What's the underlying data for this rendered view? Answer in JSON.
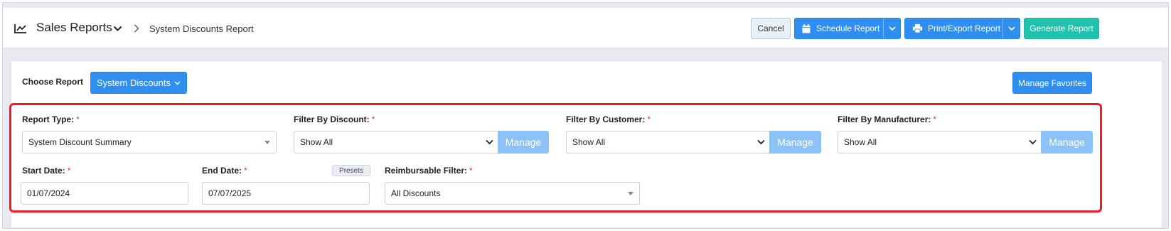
{
  "header": {
    "title": "Sales Reports",
    "breadcrumb_current": "System Discounts Report",
    "buttons": {
      "cancel": "Cancel",
      "schedule": "Schedule Report",
      "print_export": "Print/Export Report",
      "generate": "Generate Report"
    }
  },
  "report_chooser": {
    "label": "Choose Report",
    "selected": "System Discounts",
    "manage_favorites": "Manage Favorites"
  },
  "filters": {
    "report_type": {
      "label": "Report Type:",
      "value": "System Discount Summary"
    },
    "filter_by_discount": {
      "label": "Filter By Discount:",
      "value": "Show All",
      "manage": "Manage"
    },
    "filter_by_customer": {
      "label": "Filter By Customer:",
      "value": "Show All",
      "manage": "Manage"
    },
    "filter_by_manufacturer": {
      "label": "Filter By Manufacturer:",
      "value": "Show All",
      "manage": "Manage"
    },
    "start_date": {
      "label": "Start Date:",
      "value": "01/07/2024"
    },
    "end_date": {
      "label": "End Date:",
      "value": "07/07/2025",
      "presets": "Presets"
    },
    "reimbursable_filter": {
      "label": "Reimbursable Filter:",
      "value": "All Discounts"
    },
    "required_marker": "*"
  },
  "colors": {
    "primary": "#2f8ff0",
    "generate": "#21c2ad",
    "manage_button": "#8cc2f5",
    "highlight_border": "#ee1c24"
  },
  "icons": {
    "title": "line-chart-icon",
    "schedule": "calendar-icon",
    "print": "printer-icon"
  }
}
